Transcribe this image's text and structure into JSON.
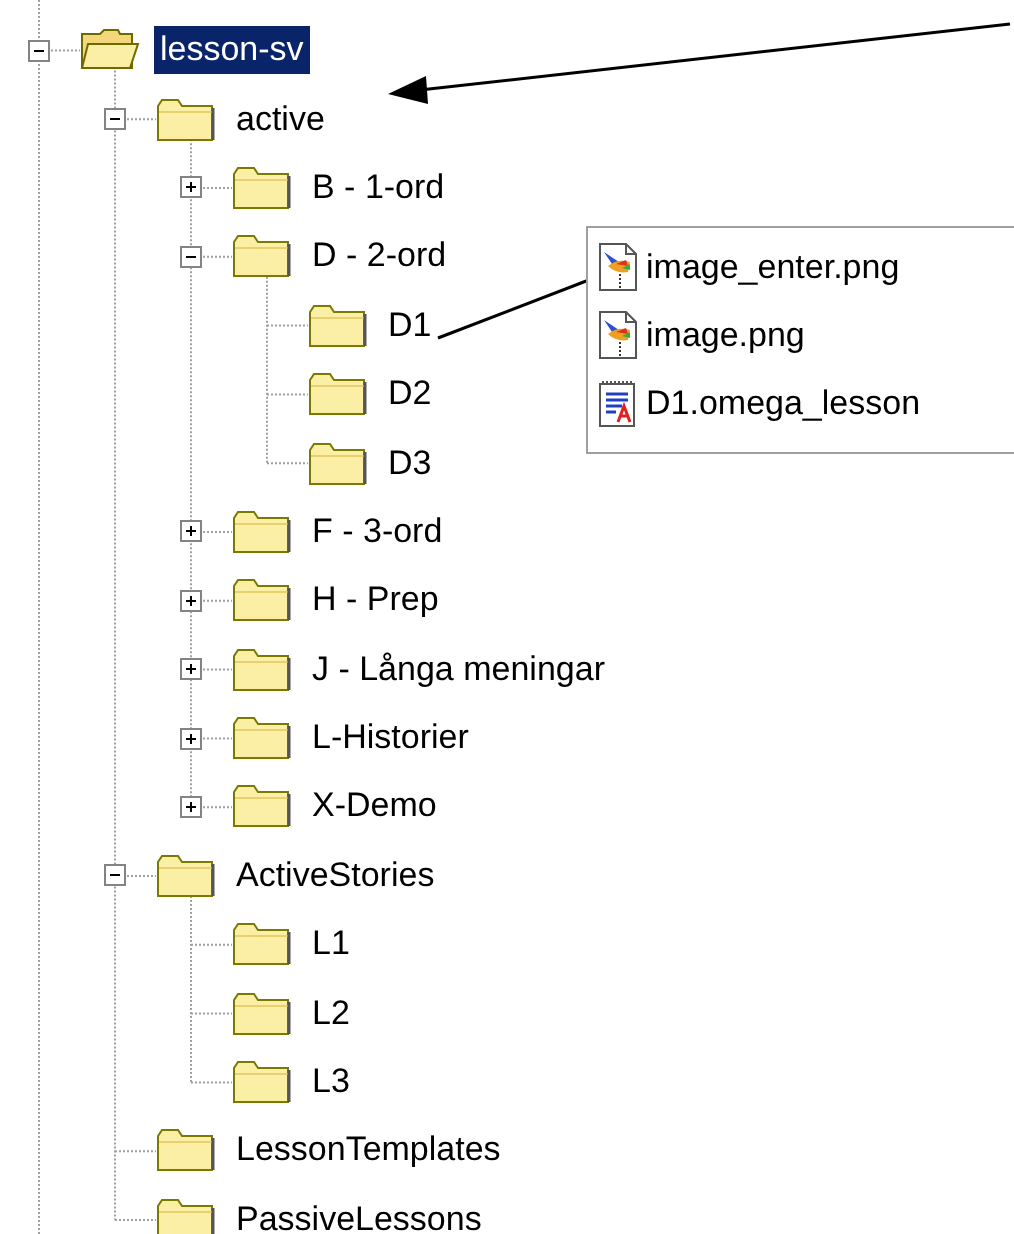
{
  "tree": [
    {
      "label": "lesson-sv",
      "selected": true,
      "expanded": true,
      "children": [
        {
          "label": "active",
          "selected": false,
          "expanded": true,
          "children": [
            {
              "label": "B - 1-ord",
              "selected": false,
              "expanded": false
            },
            {
              "label": "D - 2-ord",
              "selected": false,
              "expanded": true,
              "children": [
                {
                  "label": "D1",
                  "selected": false
                },
                {
                  "label": "D2",
                  "selected": false
                },
                {
                  "label": "D3",
                  "selected": false
                }
              ]
            },
            {
              "label": "F - 3-ord",
              "selected": false,
              "expanded": false
            },
            {
              "label": "H - Prep",
              "selected": false,
              "expanded": false
            },
            {
              "label": "J - Långa meningar",
              "selected": false,
              "expanded": false
            },
            {
              "label": "L-Historier",
              "selected": false,
              "expanded": false
            },
            {
              "label": "X-Demo",
              "selected": false,
              "expanded": false
            }
          ]
        },
        {
          "label": "ActiveStories",
          "selected": false,
          "expanded": true,
          "children": [
            {
              "label": "L1",
              "selected": false
            },
            {
              "label": "L2",
              "selected": false
            },
            {
              "label": "L3",
              "selected": false
            }
          ]
        },
        {
          "label": "LessonTemplates",
          "selected": false
        },
        {
          "label": "PassiveLessons",
          "selected": false
        }
      ]
    }
  ],
  "file_list": [
    {
      "name": "image_enter.png",
      "kind": "image"
    },
    {
      "name": "image.png",
      "kind": "image"
    },
    {
      "name": "D1.omega_lesson",
      "kind": "lesson"
    }
  ]
}
